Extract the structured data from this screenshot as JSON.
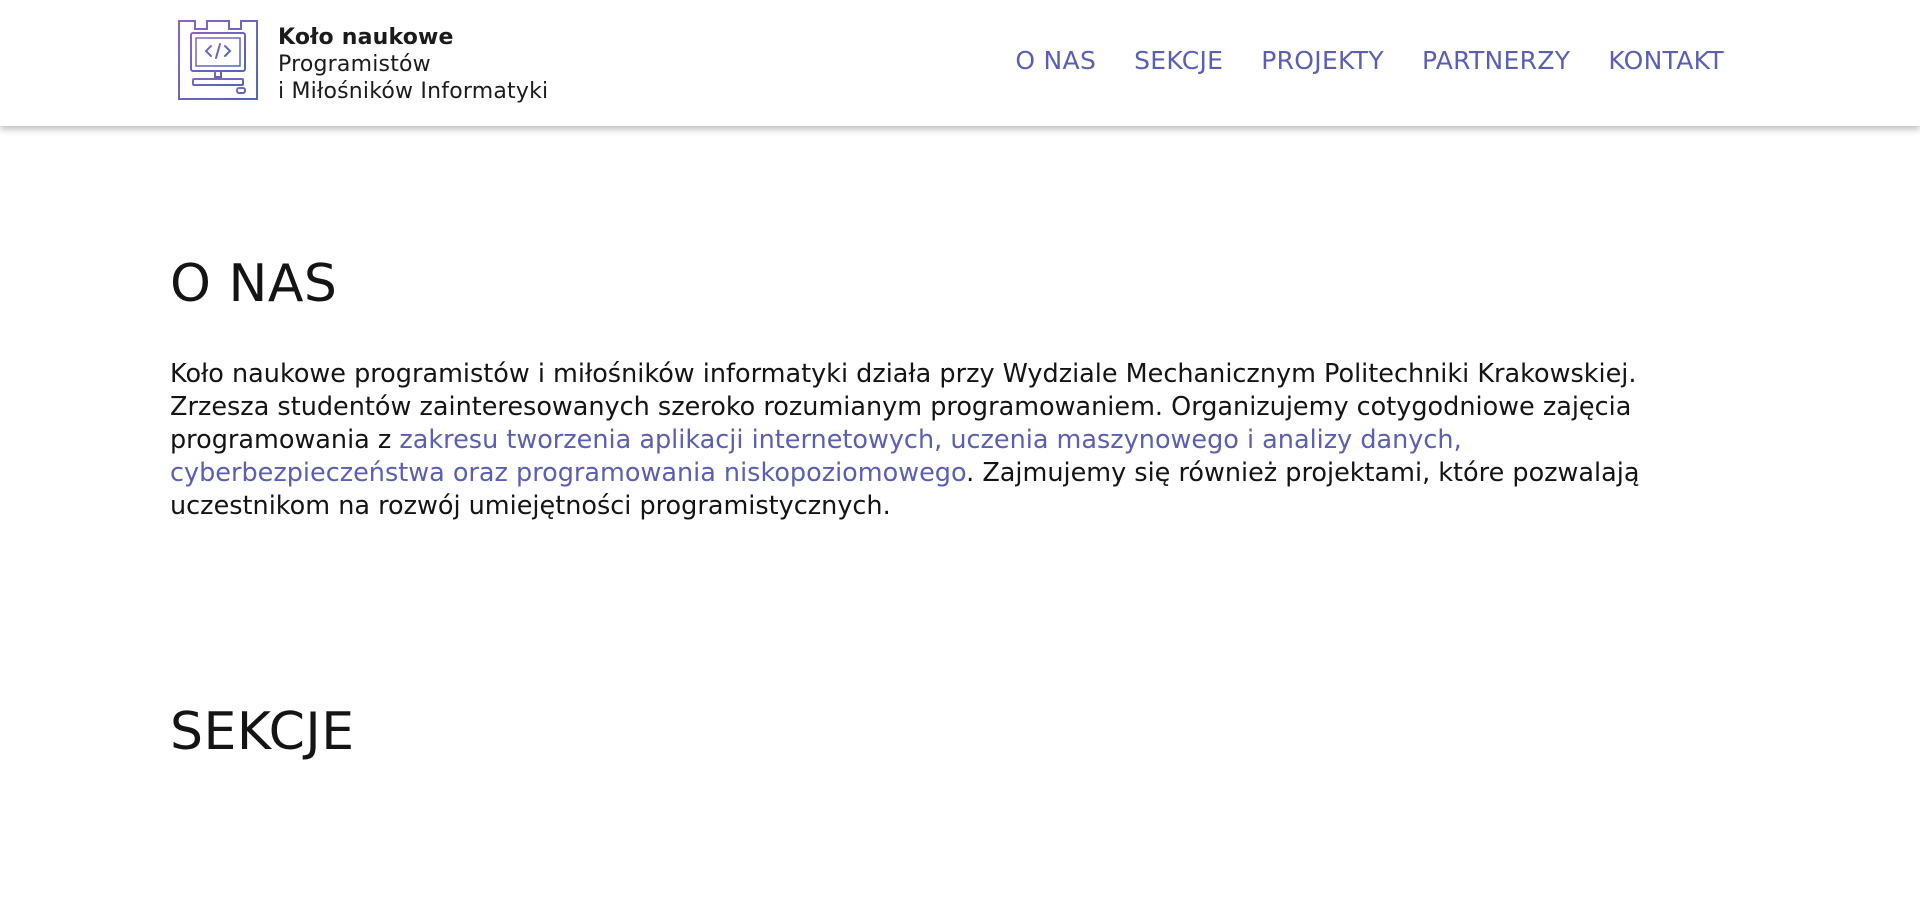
{
  "header": {
    "brand": {
      "logo_icon": "code-monitor-tower-icon",
      "line1": "Koło naukowe",
      "line2": "Programistów",
      "line3": "i Miłośników Informatyki"
    },
    "nav": [
      {
        "label": "O NAS"
      },
      {
        "label": "SEKCJE"
      },
      {
        "label": "PROJEKTY"
      },
      {
        "label": "PARTNERZY"
      },
      {
        "label": "KONTAKT"
      }
    ]
  },
  "sections": {
    "about": {
      "title": "O NAS",
      "text_before": "Koło naukowe programistów i miłośników informatyki działa przy Wydziale Mechanicznym Politechniki Krakowskiej. Zrzesza studentów zainteresowanych szeroko rozumianym programowaniem. Organizujemy cotygodniowe zajęcia programowania z ",
      "link_text": "zakresu tworzenia aplikacji internetowych, uczenia maszynowego i analizy danych, cyberbezpieczeństwa oraz programowania niskopoziomowego",
      "text_after": ". Zajmujemy się również projektami, które pozwalają uczestnikom na rozwój umiejętności programistycznych."
    },
    "sections_title": "SEKCJE"
  },
  "colors": {
    "accent": "#5b5fb4",
    "text": "#141414",
    "background": "#ffffff"
  }
}
